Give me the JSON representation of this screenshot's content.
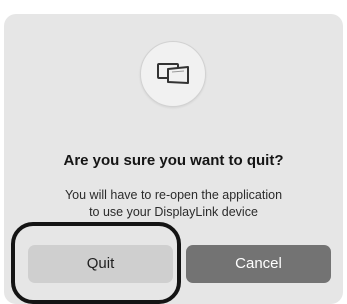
{
  "dialog": {
    "icon": "displaylink-display-icon",
    "title": "Are you sure you want to quit?",
    "message_line1": "You will have to re-open the application",
    "message_line2": "to use your DisplayLink device",
    "buttons": {
      "quit_label": "Quit",
      "cancel_label": "Cancel"
    },
    "highlighted_button": "Quit"
  },
  "colors": {
    "dialog_background": "#e6e6e6",
    "secondary_button": "#cfcfcf",
    "primary_button": "#737373",
    "highlight_ring": "#141414"
  }
}
